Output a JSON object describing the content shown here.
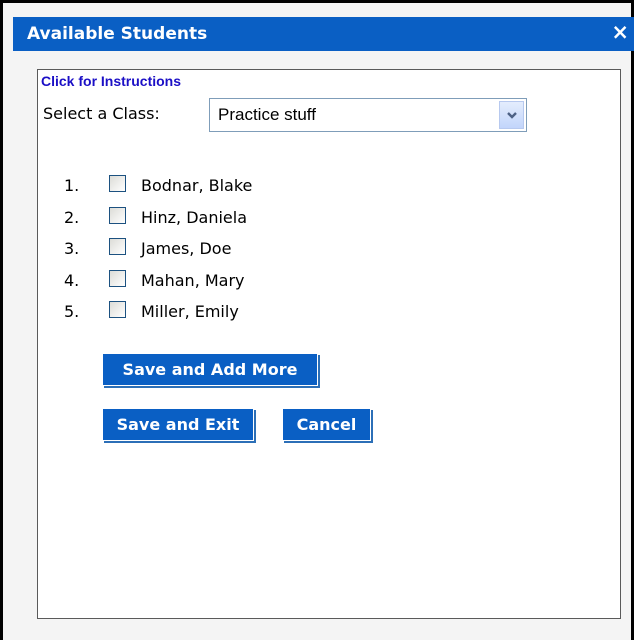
{
  "dialog": {
    "title": "Available Students",
    "close_icon": "close-icon",
    "close_glyph": "×"
  },
  "instructions_link": "Click for Instructions",
  "class_select": {
    "label": "Select a Class:",
    "value": "Practice stuff",
    "arrow_icon": "chevron-down-icon"
  },
  "students": [
    {
      "number": "1.",
      "name": "Bodnar, Blake",
      "checked": false
    },
    {
      "number": "2.",
      "name": "Hinz, Daniela",
      "checked": false
    },
    {
      "number": "3.",
      "name": "James, Doe",
      "checked": false
    },
    {
      "number": "4.",
      "name": "Mahan, Mary",
      "checked": false
    },
    {
      "number": "5.",
      "name": "Miller, Emily",
      "checked": false
    }
  ],
  "buttons": {
    "save_add_more": "Save and Add More",
    "save_exit": "Save and Exit",
    "cancel": "Cancel"
  },
  "colors": {
    "accent": "#0a5fc4",
    "link": "#1b0fc6"
  }
}
